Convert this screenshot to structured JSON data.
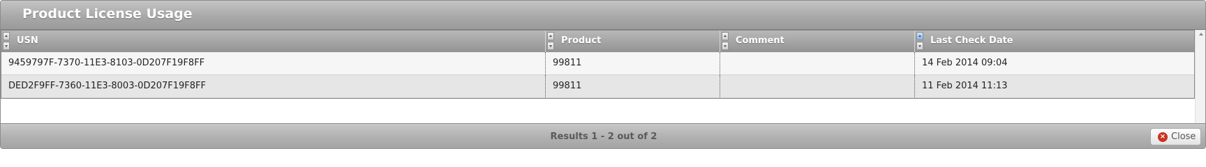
{
  "panel": {
    "title": "Product License Usage"
  },
  "table": {
    "columns": [
      {
        "label": "USN",
        "sort_active": false
      },
      {
        "label": "Product",
        "sort_active": false
      },
      {
        "label": "Comment",
        "sort_active": false
      },
      {
        "label": "Last Check Date",
        "sort_active": true
      }
    ],
    "rows": [
      {
        "usn": "9459797F-7370-11E3-8103-0D207F19F8FF",
        "product": "99811",
        "comment": "",
        "last_check_date": "14 Feb 2014 09:04"
      },
      {
        "usn": "DED2F9FF-7360-11E3-8003-0D207F19F8FF",
        "product": "99811",
        "comment": "",
        "last_check_date": "11 Feb 2014 11:13"
      }
    ]
  },
  "footer": {
    "results_text": "Results 1 - 2 out of 2",
    "close_label": "Close",
    "close_icon": "close-circle-icon"
  },
  "colors": {
    "close_icon_red": "#c8331f",
    "header_text": "#ffffff",
    "sort_active_blue": "#7eb5ee"
  }
}
